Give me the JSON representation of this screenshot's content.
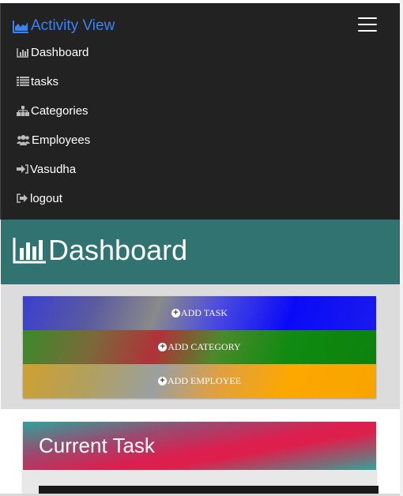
{
  "navbar": {
    "brand_label": "Activity View",
    "brand_icon": "area-chart-icon",
    "toggle_icon": "hamburger-icon",
    "items": [
      {
        "label": "Dashboard",
        "icon": "bar-chart-icon"
      },
      {
        "label": "tasks",
        "icon": "list-icon"
      },
      {
        "label": "Categories",
        "icon": "sitemap-icon"
      },
      {
        "label": "Employees",
        "icon": "users-icon"
      },
      {
        "label": "Vasudha",
        "icon": "sign-in-icon"
      },
      {
        "label": "logout",
        "icon": "sign-out-icon"
      }
    ]
  },
  "hero": {
    "title": "Dashboard",
    "icon": "bar-chart-icon"
  },
  "actions": {
    "add_task": "ADD TASK",
    "add_category": "ADD CATEGORY",
    "add_employee": "ADD EMPLOYEE"
  },
  "current_task": {
    "title": "Current Task"
  },
  "colors": {
    "navbar_bg": "#222222",
    "brand": "#3b82f6",
    "hero_bg": "#307371",
    "task_blue": "#0a0af8",
    "category_green": "#108a10",
    "employee_orange": "#fda800",
    "crimson": "#dc1f4f"
  }
}
